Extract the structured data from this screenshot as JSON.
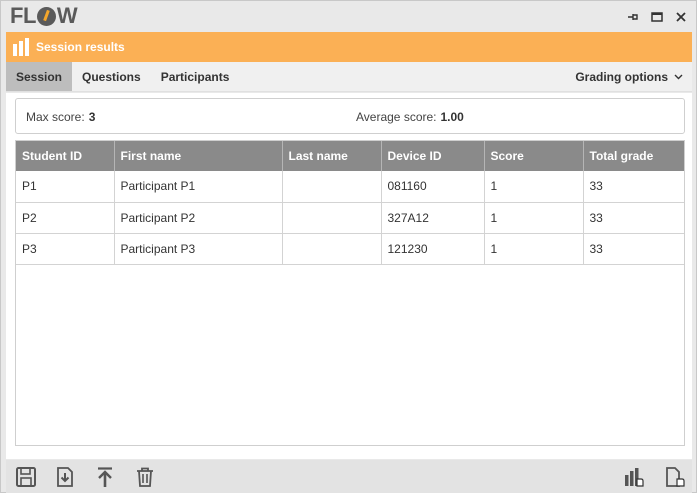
{
  "app": {
    "logo_text": "FLOW"
  },
  "window_controls": {
    "pin_icon": "pin-icon",
    "maximize_icon": "maximize-icon",
    "close_icon": "close-icon"
  },
  "header": {
    "title": "Session results",
    "icon": "bar-chart-icon",
    "bg_color": "#fbb055"
  },
  "tabs": [
    {
      "label": "Session",
      "active": true
    },
    {
      "label": "Questions",
      "active": false
    },
    {
      "label": "Participants",
      "active": false
    }
  ],
  "grading": {
    "label": "Grading options",
    "icon": "chevron-down-icon"
  },
  "summary": {
    "max_score_label": "Max score:",
    "max_score_value": "3",
    "average_label": "Average score:",
    "average_value": "1.00"
  },
  "table": {
    "columns": [
      "Student ID",
      "First name",
      "Last name",
      "Device ID",
      "Score",
      "Total grade"
    ],
    "rows": [
      [
        "P1",
        "Participant P1",
        "",
        "081160",
        "1",
        "33"
      ],
      [
        "P2",
        "Participant P2",
        "",
        "327A12",
        "1",
        "33"
      ],
      [
        "P3",
        "Participant P3",
        "",
        "121230",
        "1",
        "33"
      ]
    ],
    "header_color": "#8a8a8a"
  },
  "toolbar": {
    "left": [
      "save-icon",
      "import-icon",
      "upload-icon",
      "trash-icon"
    ],
    "right": [
      "chart-results-icon",
      "report-icon"
    ]
  }
}
